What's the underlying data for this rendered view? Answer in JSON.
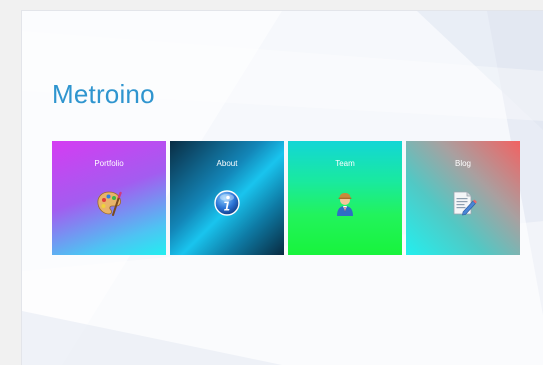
{
  "site": {
    "title": "Metroino"
  },
  "tiles": [
    {
      "label": "Portfolio",
      "icon": "palette-icon"
    },
    {
      "label": "About",
      "icon": "info-icon"
    },
    {
      "label": "Team",
      "icon": "person-icon"
    },
    {
      "label": "Blog",
      "icon": "document-edit-icon"
    }
  ],
  "colors": {
    "title": "#2f95cf",
    "portfolio_top": "#d53cf2",
    "portfolio_bottom": "#22eef0",
    "about_dark": "#0a2d44",
    "about_light": "#19c4ee",
    "team_top": "#13d6d6",
    "team_bottom": "#18f33c",
    "blog_top": "#f26262",
    "blog_bottom": "#23efee"
  }
}
